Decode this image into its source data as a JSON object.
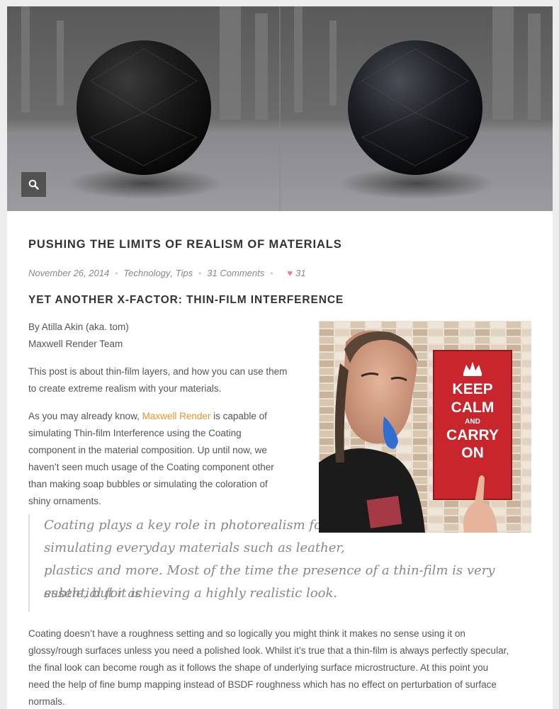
{
  "post": {
    "title": "PUSHING THE LIMITS OF REALISM OF MATERIALS",
    "date": "November 26, 2014",
    "categories": [
      "Technology",
      "Tips"
    ],
    "comments": "31 Comments",
    "likes": "31",
    "subtitle": "YET ANOTHER X-FACTOR: THIN-FILM INTERFERENCE",
    "author_line": "By Atilla Akin (aka. tom)",
    "team_line": "Maxwell Render Team",
    "intro_line1": "This post is about thin-film layers, and how you can use them",
    "intro_line2": "to create extreme realism with your materials.",
    "p2_pre": "As you may already know, ",
    "p2_link": "Maxwell Render",
    "p2_post": " is capable of",
    "p2_line2": "simulating Thin-film Interference using the Coating",
    "p2_line3": "component in the material composition. Up until now, we",
    "p2_line4": "haven’t seen much usage of the Coating component other",
    "p2_line5": "than making soap bubbles or simulating the coloration of",
    "p2_line6": "shiny ornaments.",
    "quote_line1": "Coating plays a key role in photorealism for",
    "quote_line2": "simulating everyday materials such as leather,",
    "quote_line3": "plastics and more. Most of the time the presence of a thin-film is very subtle, but it is",
    "quote_line4": "essential for achieving a highly realistic look.",
    "p3_line1": "Coating doesn’t have a roughness setting and so logically you might think it makes no sense using it on",
    "p3_line2": "glossy/rough surfaces unless you need a polished look. Whilst it’s true that a thin-film is always perfectly specular,",
    "p3_line3": "the final look can become rough as it follows the shape of underlying surface microstructure. At this point you",
    "p3_line4": "need the help of fine bump mapping instead of BSDF roughness which has no effect on perturbation of surface",
    "p3_line5": "normals."
  },
  "poster": {
    "line1": "KEEP",
    "line2": "CALM",
    "line3": "AND",
    "line4": "CARRY",
    "line5": "ON"
  },
  "icons": {
    "zoom": "search-icon",
    "like": "heart-icon",
    "crown": "crown-icon"
  },
  "colors": {
    "link": "#e8922e",
    "heart": "#e0828e",
    "poster_red": "#c8252c"
  }
}
